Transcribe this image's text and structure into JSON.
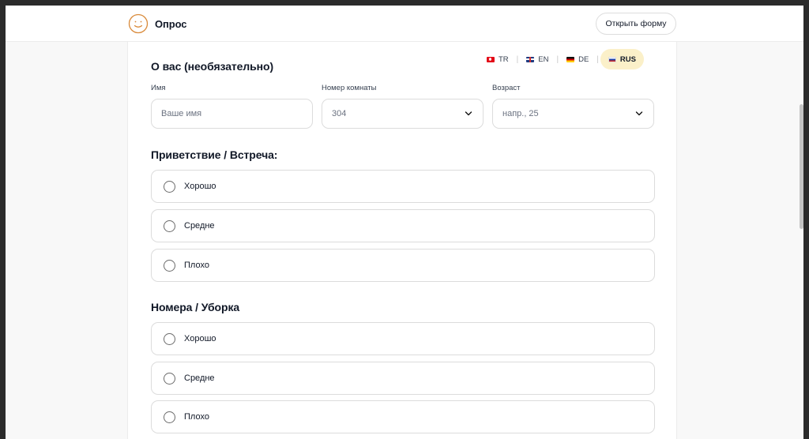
{
  "header": {
    "brand": "Опрос",
    "open_form_label": "Открыть форму",
    "logo_icon": "smiley-face-icon"
  },
  "about": {
    "title": "О вас (необязательно)",
    "languages": [
      {
        "code": "TR",
        "flag": "flag-tr-icon",
        "active": false
      },
      {
        "code": "EN",
        "flag": "flag-en-icon",
        "active": false
      },
      {
        "code": "DE",
        "flag": "flag-de-icon",
        "active": false
      },
      {
        "code": "RUS",
        "flag": "flag-ru-icon",
        "active": true
      }
    ],
    "name": {
      "label": "Имя",
      "placeholder": "Ваше имя"
    },
    "room": {
      "label": "Номер комнаты",
      "value": "304"
    },
    "age": {
      "label": "Возраст",
      "placeholder": "напр., 25"
    }
  },
  "questions": [
    {
      "title": "Приветствие / Встреча:",
      "options": [
        "Хорошо",
        "Средне",
        "Плохо"
      ]
    },
    {
      "title": "Номера / Уборка",
      "options": [
        "Хорошо",
        "Средне",
        "Плохо"
      ]
    }
  ],
  "colors": {
    "accent": "#fbf0c9",
    "logo": "#d98a3a",
    "border": "#dcdcdc",
    "text": "#111827"
  }
}
